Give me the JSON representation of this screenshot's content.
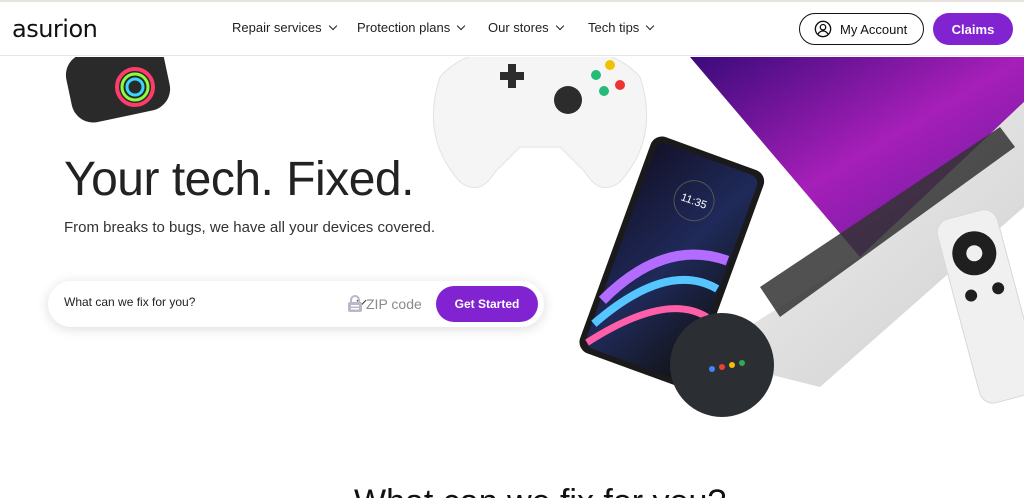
{
  "header": {
    "logo": "asurion",
    "nav": [
      {
        "label": "Repair services"
      },
      {
        "label": "Protection plans"
      },
      {
        "label": "Our stores"
      },
      {
        "label": "Tech tips"
      }
    ],
    "account_label": "My Account",
    "claims_label": "Claims"
  },
  "hero": {
    "title": "Your tech. Fixed.",
    "subtitle": "From breaks to bugs, we have all your devices covered.",
    "search": {
      "select_value": "What can we fix for you?",
      "zip_placeholder": "ZIP code",
      "button_label": "Get Started"
    }
  },
  "phone": {
    "time": "11:35"
  },
  "next_section": {
    "heading_partial": "What can we fix for you?"
  },
  "colors": {
    "brand_purple": "#8223d2",
    "text": "#222222"
  },
  "icons": [
    "user-circle-icon",
    "chevron-down-icon",
    "zip-lock-icon"
  ]
}
